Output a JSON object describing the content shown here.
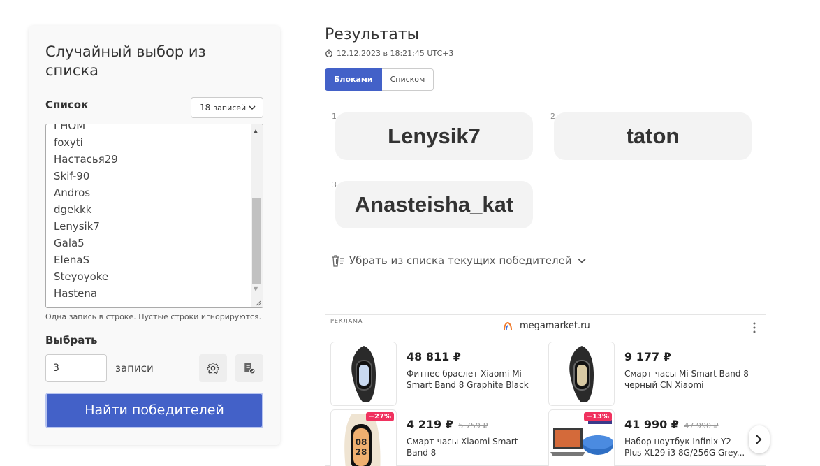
{
  "left_panel": {
    "title": "Случайный выбор из списка",
    "list_label": "Список",
    "count_select": {
      "number": "18",
      "unit": "записей"
    },
    "entries_visible": [
      "ГНОМ",
      "foxyti",
      "Настасья29",
      "Skif-90",
      "Andros",
      "dgekkk",
      "Lenysik7",
      "Gala5",
      "ElenaS",
      "Steyoyoke",
      "Hastena"
    ],
    "hint": "Одна запись в строке. Пустые строки игнорируются.",
    "choose_label": "Выбрать",
    "choose_value": "3",
    "choose_unit": "записи",
    "find_button": "Найти победителей"
  },
  "results": {
    "title": "Результаты",
    "timestamp": "12.12.2023 в 18:21:45 UTC+3",
    "view_toggle": {
      "blocks": "Блоками",
      "list": "Списком",
      "active": "blocks"
    },
    "winners": [
      {
        "num": "1",
        "name": "Lenysik7"
      },
      {
        "num": "2",
        "name": "taton"
      },
      {
        "num": "3",
        "name": "Anasteisha_kat"
      }
    ],
    "remove_winners": "Убрать из списка текущих победителей"
  },
  "ad": {
    "tag": "РЕКЛАМА",
    "brand": "megamarket.ru",
    "products": [
      {
        "price": "48 811 ₽",
        "old_price": "",
        "discount": "",
        "name": "Фитнес-браслет Xiaomi Mi Smart Band 8 Graphite Black"
      },
      {
        "price": "9 177 ₽",
        "old_price": "",
        "discount": "",
        "name": "Смарт-часы Mi Smart Band 8 черный CN Xiaomi"
      },
      {
        "price": "4 219 ₽",
        "old_price": "5 759 ₽",
        "discount": "−27%",
        "name": "Смарт-часы Xiaomi Smart Band 8"
      },
      {
        "price": "41 990 ₽",
        "old_price": "47 990 ₽",
        "discount": "−13%",
        "name": "Набор ноутбук Infinix Y2 Plus XL29 i3 8G/256G Grey..."
      }
    ]
  },
  "colors": {
    "accent": "#4361c8",
    "discount": "#f0325f"
  }
}
